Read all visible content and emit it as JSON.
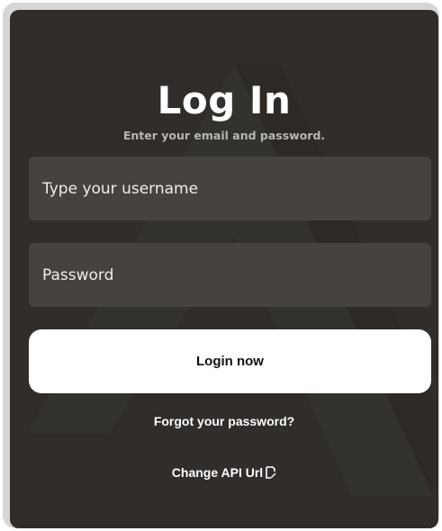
{
  "login": {
    "title": "Log In",
    "subtitle": "Enter your email and password.",
    "username_placeholder": "Type your username",
    "password_placeholder": "Password",
    "login_button": "Login now",
    "forgot_password": "Forgot your password?",
    "change_api": "Change API Url",
    "change_api_icon": "edit-document-icon"
  },
  "colors": {
    "background": "#302d2b",
    "field": "#45423f",
    "button": "#ffffff",
    "subtitle": "#b9b6b3"
  }
}
